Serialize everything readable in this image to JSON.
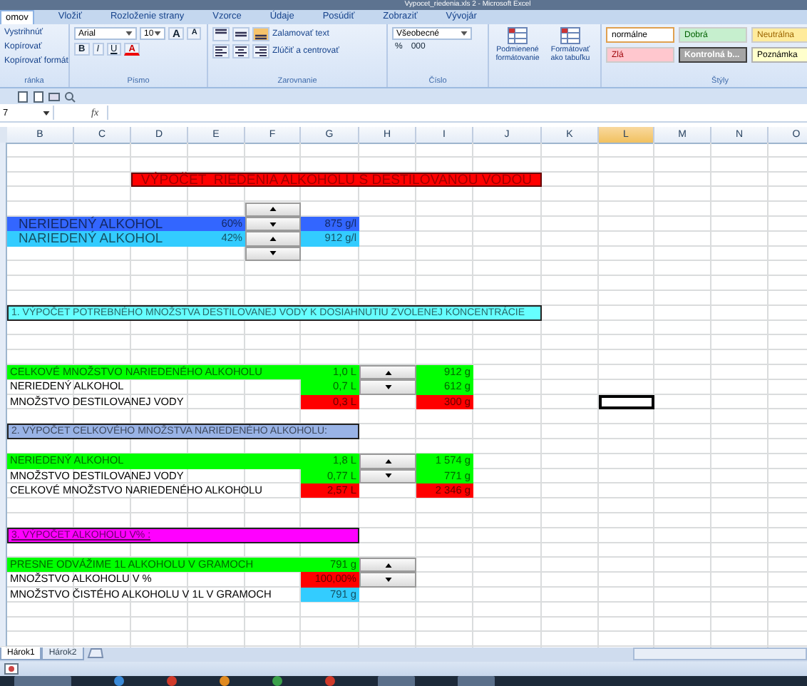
{
  "window": {
    "title": "Vypocet_riedenia.xls 2 - Microsoft Excel"
  },
  "ribbon_tabs": [
    {
      "label": "omov",
      "selected": true
    },
    {
      "label": "Vložiť",
      "selected": false
    },
    {
      "label": "Rozloženie strany",
      "selected": false
    },
    {
      "label": "Vzorce",
      "selected": false
    },
    {
      "label": "Údaje",
      "selected": false
    },
    {
      "label": "Posúdiť",
      "selected": false
    },
    {
      "label": "Zobraziť",
      "selected": false
    },
    {
      "label": "Vývojár",
      "selected": false
    }
  ],
  "ribbon": {
    "clipboard": {
      "items": [
        "Vystrihnúť",
        "Kopírovať",
        "Kopírovať formát"
      ],
      "label": "ránka"
    },
    "font": {
      "name": "Arial",
      "size": "10",
      "label": "Písmo",
      "buttons": [
        {
          "label": "A",
          "kind": "grow"
        },
        {
          "label": "A",
          "kind": "shrink"
        },
        {
          "label": "B",
          "kind": "bold"
        },
        {
          "label": "I",
          "kind": "italic"
        },
        {
          "label": "U",
          "kind": "underline"
        },
        {
          "label": "A",
          "kind": "color"
        }
      ]
    },
    "alignment": {
      "wrap": "Zalamovať text",
      "merge": "Zlúčiť a centrovať",
      "label": "Zarovnanie"
    },
    "number": {
      "format": "Všeobecné",
      "symbols": [
        "%",
        "000"
      ],
      "label": "Číslo"
    },
    "format_buttons": [
      "Podmienené formátovanie",
      "Formátovať ako tabuľku"
    ],
    "styles": {
      "label": "Štýly",
      "items": [
        {
          "label": "normálne",
          "kind": "normal"
        },
        {
          "label": "Dobrá",
          "kind": "good"
        },
        {
          "label": "Neutrálna",
          "kind": "neutral"
        },
        {
          "label": "Zlá",
          "kind": "bad"
        },
        {
          "label": "Kontrolná b...",
          "kind": "check"
        },
        {
          "label": "Poznámka",
          "kind": "note"
        }
      ]
    }
  },
  "formula_bar": {
    "name_box": "7",
    "fx": "fx"
  },
  "columns": [
    {
      "label": "B",
      "selected": false
    },
    {
      "label": "C",
      "selected": false
    },
    {
      "label": "D",
      "selected": false
    },
    {
      "label": "E",
      "selected": false
    },
    {
      "label": "F",
      "selected": false
    },
    {
      "label": "G",
      "selected": false
    },
    {
      "label": "H",
      "selected": false
    },
    {
      "label": "I",
      "selected": false
    },
    {
      "label": "J",
      "selected": false
    },
    {
      "label": "K",
      "selected": false
    },
    {
      "label": "L",
      "selected": true
    },
    {
      "label": "M",
      "selected": false
    },
    {
      "label": "N",
      "selected": false
    },
    {
      "label": "O",
      "selected": false
    }
  ],
  "sheet": {
    "title": "VÝPOČET  RIEDENIA ALKOHOLU S DESTILOVANOU VODOU",
    "inputs": [
      {
        "label": "NERIEDENÝ ALKOHOL",
        "percent": "60%",
        "density": "875 g/l",
        "color": "#3366ff"
      },
      {
        "label": "NARIEDENÝ ALKOHOL",
        "percent": "42%",
        "density": "912 g/l",
        "color": "#33ccff"
      }
    ],
    "input_spinner": [
      {
        "kind": "up"
      },
      {
        "kind": "down"
      },
      {
        "kind": "up"
      },
      {
        "kind": "down"
      }
    ],
    "sections": [
      {
        "heading": "1. VÝPOČET POTREBNÉHO MNOŽSTVA DESTILOVANEJ VODY K DOSIAHNUTIU ZVOLENEJ KONCENTRÁCIE",
        "color": "#66ffff",
        "underlined": false,
        "rows": [
          {
            "label": {
              "text": "CELKOVÉ MNOŽSTVO NARIEDENÉHO ALKOHOLU",
              "color": "#00ff00"
            },
            "volume": {
              "text": "1,0 L",
              "color": "#00ff00"
            },
            "spinner": {
              "kind": "up"
            },
            "mass": {
              "text": "912 g",
              "color": "#00ff00"
            }
          },
          {
            "label": {
              "text": "NERIEDENÝ ALKOHOL"
            },
            "volume": {
              "text": "0,7 L",
              "color": "#00ff00"
            },
            "spinner": {
              "kind": "down"
            },
            "mass": {
              "text": "612 g",
              "color": "#00ff00"
            }
          },
          {
            "label": {
              "text": "MNOŽSTVO DESTILOVANEJ VODY"
            },
            "volume": {
              "text": "0,3 L",
              "color": "#ff0000"
            },
            "mass": {
              "text": "300 g",
              "color": "#ff0000"
            }
          }
        ]
      },
      {
        "heading": "2. VÝPOČET CELKOVÉHO MNOŽSTVA NARIEDENÉHO ALKOHOLU:",
        "color": "#99b3e6",
        "underlined": false,
        "rows": [
          {
            "label": {
              "text": "NERIEDENÝ ALKOHOL",
              "color": "#00ff00"
            },
            "volume": {
              "text": "1,8 L",
              "color": "#00ff00"
            },
            "spinner": {
              "kind": "up"
            },
            "mass": {
              "text": "1 574 g",
              "color": "#00ff00"
            }
          },
          {
            "label": {
              "text": "MNOŽSTVO DESTILOVANEJ VODY"
            },
            "volume": {
              "text": "0,77 L",
              "color": "#00ff00"
            },
            "spinner": {
              "kind": "down"
            },
            "mass": {
              "text": "771 g",
              "color": "#00ff00"
            }
          },
          {
            "label": {
              "text": "CELKOVÉ MNOŽSTVO NARIEDENÉHO ALKOHOLU"
            },
            "volume": {
              "text": "2,57 L",
              "color": "#ff0000"
            },
            "mass": {
              "text": "2 346 g",
              "color": "#ff0000"
            }
          }
        ]
      },
      {
        "heading": "3. VÝPOČET ALKOHOLU V% :",
        "color": "#ff00ff",
        "underlined": true,
        "rows": [
          {
            "label": {
              "text": "PRESNE ODVÁŽIME 1L ALKOHOLU V GRAMOCH",
              "color": "#00ff00"
            },
            "volume": {
              "text": "791 g",
              "color": "#00ff00"
            },
            "spinner": {
              "kind": "up"
            }
          },
          {
            "label": {
              "text": "MNOŽSTVO ALKOHOLU V  %"
            },
            "volume": {
              "text": "100,00%",
              "color": "#ff0000"
            },
            "spinner": {
              "kind": "down"
            }
          },
          {
            "label": {
              "text": "MNOŽSTVO ČISTÉHO ALKOHOLU V 1L V GRAMOCH"
            },
            "volume": {
              "text": "791 g",
              "color": "#33ccff"
            }
          }
        ]
      }
    ]
  },
  "sheet_tabs": [
    {
      "label": "Hárok1",
      "selected": true
    },
    {
      "label": "Hárok2",
      "selected": false
    }
  ]
}
